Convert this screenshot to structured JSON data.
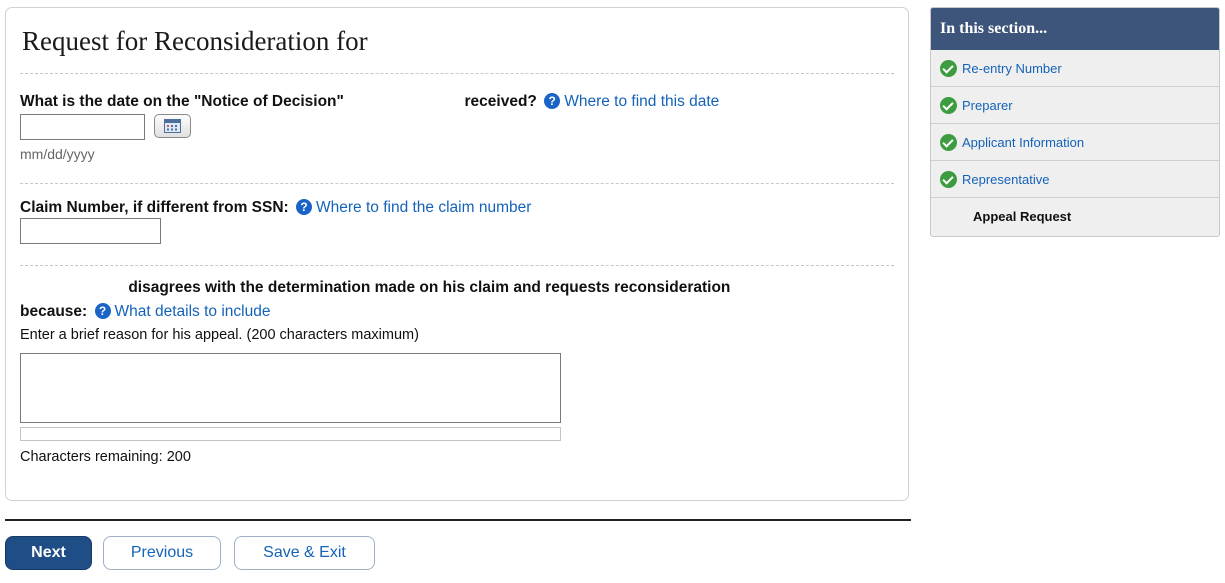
{
  "page": {
    "title": "Request for Reconsideration for"
  },
  "form": {
    "notice_date": {
      "label_part1": "What is the date on the \"Notice of Decision\"",
      "label_part2": "received?",
      "help_link": "Where to find this date",
      "value": "",
      "hint": "mm/dd/yyyy"
    },
    "claim_number": {
      "label": "Claim Number, if different from SSN:",
      "help_link": "Where to find the claim number",
      "value": ""
    },
    "reason": {
      "label_line1": "disagrees with the determination made on his claim and requests reconsideration",
      "label_line2": "because:",
      "help_link": "What details to include",
      "instruction": "Enter a brief reason for his appeal. (200 characters maximum)",
      "value": "",
      "counter_label": "Characters remaining:",
      "counter_value": "200"
    }
  },
  "buttons": {
    "next": "Next",
    "previous": "Previous",
    "save_exit": "Save & Exit"
  },
  "sidebar": {
    "heading": "In this section...",
    "items": [
      {
        "label": "Re-entry Number",
        "status": "complete"
      },
      {
        "label": "Preparer",
        "status": "complete"
      },
      {
        "label": "Applicant Information",
        "status": "complete"
      },
      {
        "label": "Representative",
        "status": "complete"
      },
      {
        "label": "Appeal Request",
        "status": "current"
      }
    ]
  },
  "colors": {
    "link": "#1463b8",
    "primary_button": "#1f4e86",
    "sidebar_header": "#3d557a",
    "check_green": "#3e9c40"
  }
}
